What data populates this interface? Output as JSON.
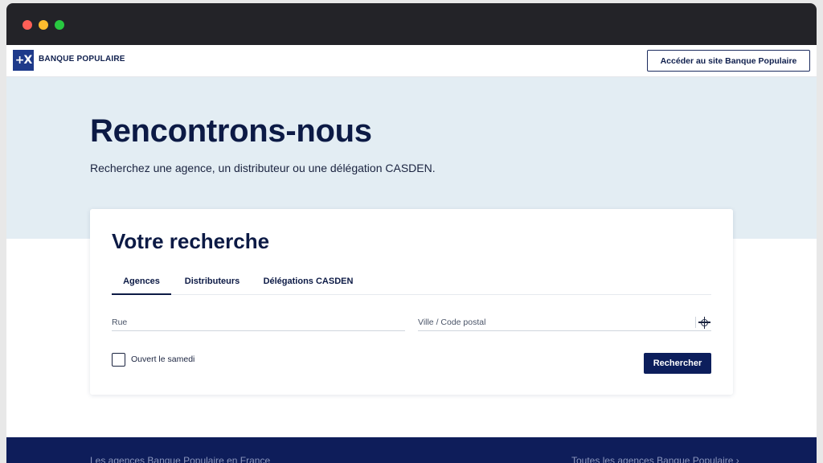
{
  "header": {
    "brand": "BANQUE POPULAIRE",
    "logo_glyph": "+X",
    "access_button": "Accéder au site Banque Populaire"
  },
  "hero": {
    "title": "Rencontrons-nous",
    "subtitle": "Recherchez une agence, un distributeur ou une délégation CASDEN."
  },
  "search": {
    "title": "Votre recherche",
    "tabs": [
      {
        "label": "Agences",
        "active": true
      },
      {
        "label": "Distributeurs",
        "active": false
      },
      {
        "label": "Délégations CASDEN",
        "active": false
      }
    ],
    "street_placeholder": "Rue",
    "city_placeholder": "Ville / Code postal",
    "geolocate_icon": "crosshair-icon",
    "saturday_label": "Ouvert le samedi",
    "saturday_checked": false,
    "submit_label": "Rechercher"
  },
  "footer": {
    "left_text": "Les agences Banque Populaire en France",
    "right_text": "Toutes les agences Banque Populaire  ›"
  },
  "colors": {
    "brand_navy": "#0c1e5c",
    "hero_bg": "#e3edf3",
    "footer_bg": "#0e1d5a"
  }
}
